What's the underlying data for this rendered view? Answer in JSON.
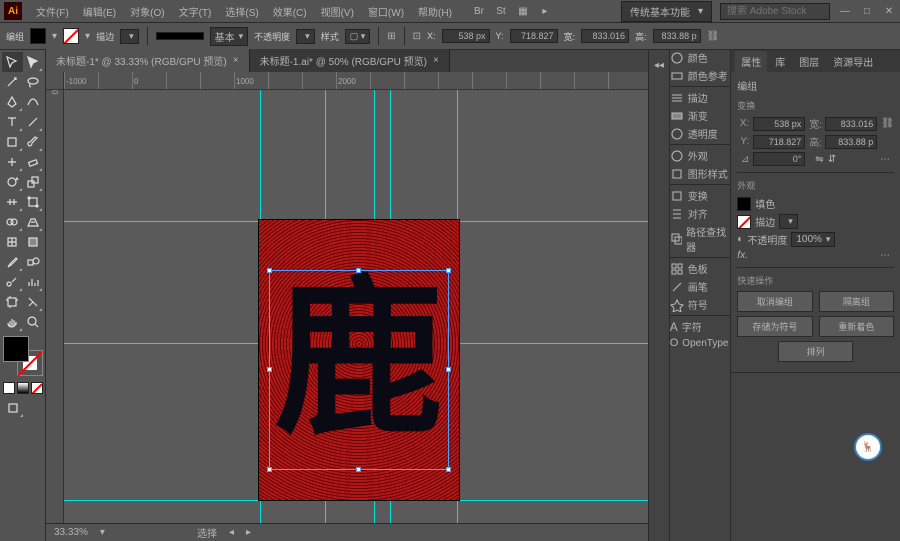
{
  "menubar": {
    "items": [
      "文件(F)",
      "编辑(E)",
      "对象(O)",
      "文字(T)",
      "选择(S)",
      "效果(C)",
      "视图(V)",
      "窗口(W)",
      "帮助(H)"
    ],
    "workspace": "传统基本功能",
    "search_placeholder": "搜索 Adobe Stock"
  },
  "controlbar": {
    "label": "编组",
    "stroke_label": "描边",
    "stroke_weight": "",
    "style_label": "基本",
    "opacity_label": "不透明度",
    "opacity": "",
    "style2_label": "样式",
    "x": "538 px",
    "y": "718.827",
    "w": "833.016",
    "h": "833.88 p"
  },
  "tabs": [
    {
      "label": "未标题-1* @ 33.33% (RGB/GPU 预览)",
      "active": true
    },
    {
      "label": "未标题-1.ai* @ 50% (RGB/GPU 预览)",
      "active": false
    }
  ],
  "ruler_h": [
    "-1000",
    "",
    "0",
    "",
    "",
    "1000",
    "",
    "",
    "2000",
    ""
  ],
  "ruler_v": [
    "0",
    "",
    "",
    "",
    "",
    "",
    "",
    "",
    "",
    "",
    "",
    "",
    ""
  ],
  "canvas": {
    "glyph": "鹿"
  },
  "statusbar": {
    "zoom": "33.33%",
    "mode": "选择"
  },
  "dock_panels": [
    {
      "label": "颜色"
    },
    {
      "label": "颜色参考"
    },
    {
      "label": "描边"
    },
    {
      "label": "渐变"
    },
    {
      "label": "透明度"
    },
    {
      "label": "外观"
    },
    {
      "label": "图形样式"
    },
    {
      "label": "变换"
    },
    {
      "label": "对齐"
    },
    {
      "label": "路径查找器"
    },
    {
      "label": "色板"
    },
    {
      "label": "画笔"
    },
    {
      "label": "符号"
    },
    {
      "label": "字符"
    },
    {
      "label": "OpenType"
    }
  ],
  "props": {
    "tabs": [
      "属性",
      "库",
      "图层",
      "资源导出"
    ],
    "group_label": "编组",
    "transform_title": "变换",
    "x": "538 px",
    "y": "718.827",
    "w": "833.016",
    "h": "833.88 p",
    "rotate": "0°",
    "appearance_title": "外观",
    "fill_label": "填色",
    "stroke_label": "描边",
    "stroke_val": "",
    "opacity_label": "不透明度",
    "opacity_val": "100%",
    "fx_label": "fx.",
    "quick_title": "快速操作",
    "btns": [
      "取消编组",
      "隔离组",
      "存储为符号",
      "重新着色"
    ],
    "align_btn": "排列"
  }
}
